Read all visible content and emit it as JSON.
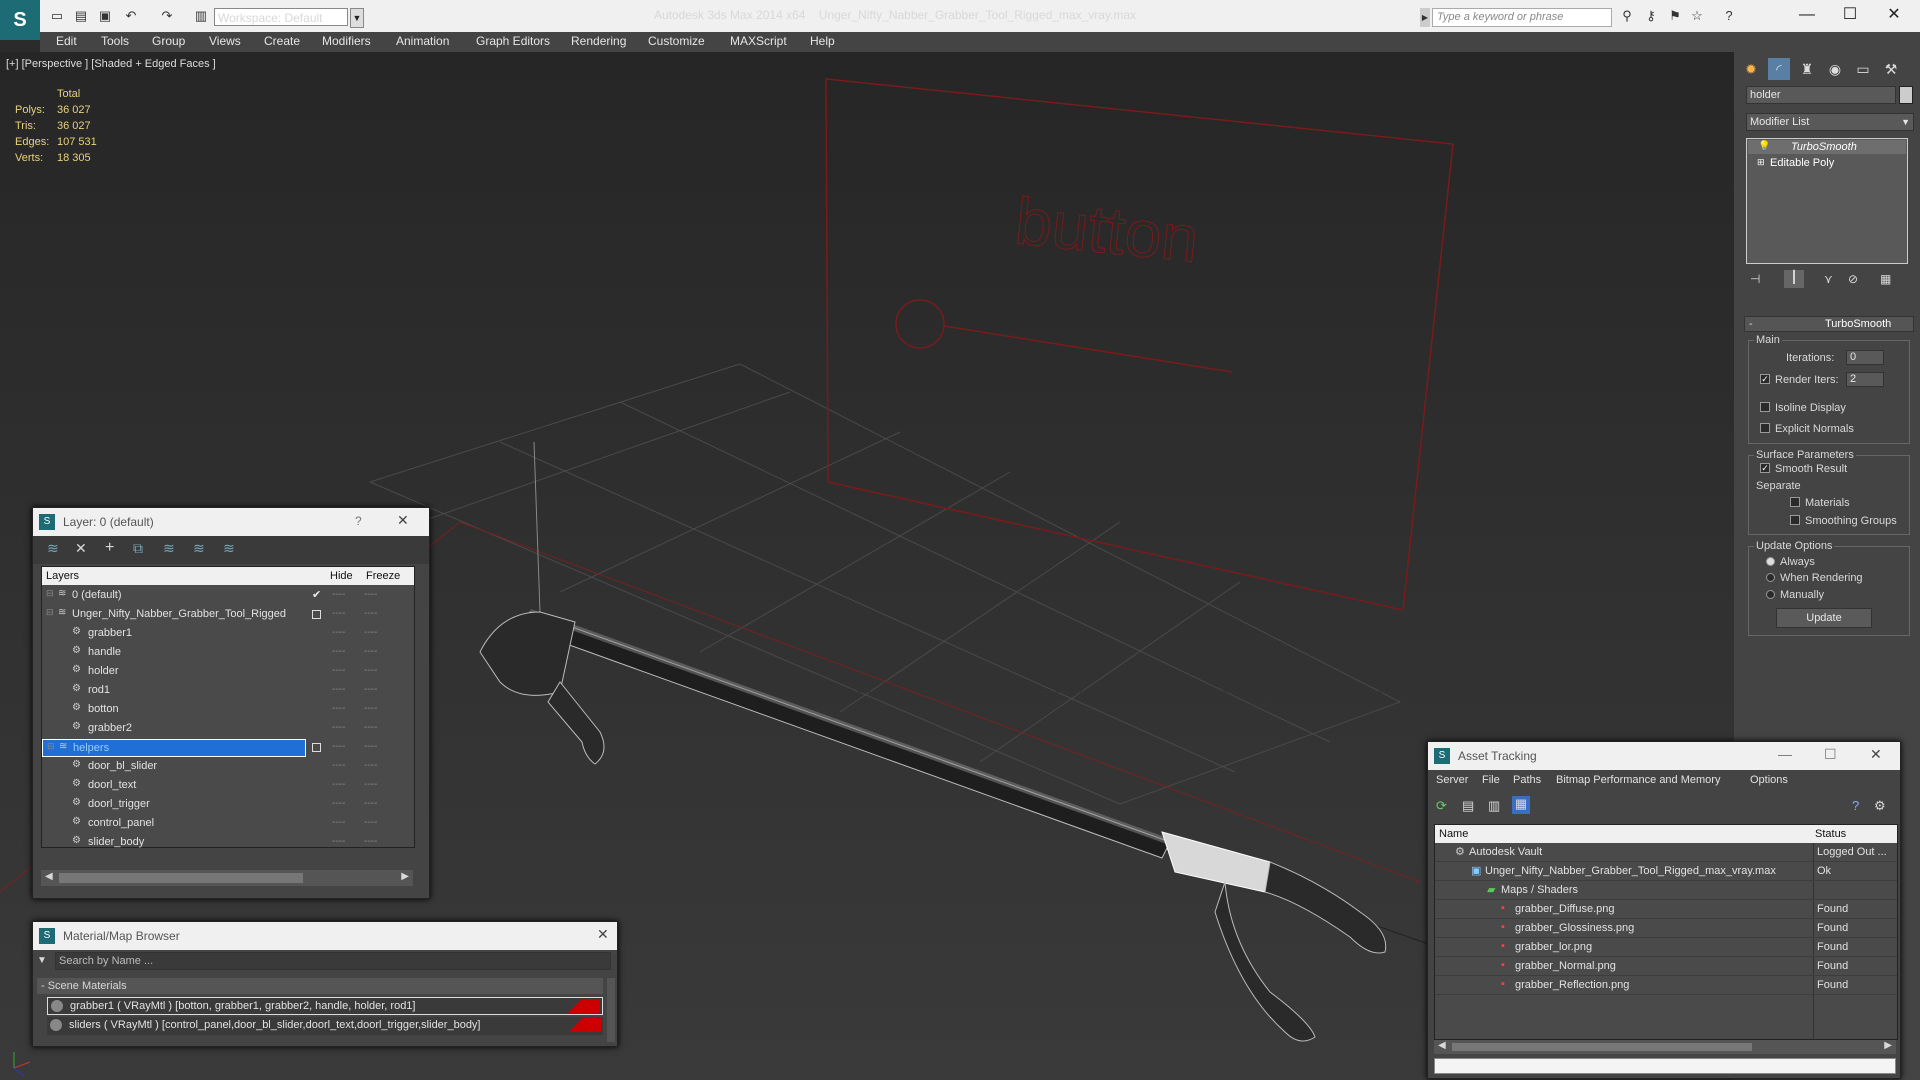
{
  "titlebar": {
    "app": "Autodesk 3ds Max  2014 x64",
    "file": "Unger_Nifty_Nabber_Grabber_Tool_Rigged_max_vray.max",
    "workspace": "Workspace: Default",
    "search_placeholder": "Type a keyword or phrase"
  },
  "menu": [
    "Edit",
    "Tools",
    "Group",
    "Views",
    "Create",
    "Modifiers",
    "Animation",
    "Graph Editors",
    "Rendering",
    "Customize",
    "MAXScript",
    "Help"
  ],
  "viewport": {
    "label": "[+] [Perspective ] [Shaded + Edged Faces ]",
    "stats_header": "Total",
    "stats": [
      {
        "k": "Polys:",
        "v": "36 027"
      },
      {
        "k": "Tris:",
        "v": "36 027"
      },
      {
        "k": "Edges:",
        "v": "107 531"
      },
      {
        "k": "Verts:",
        "v": "18 305"
      }
    ],
    "scene_text": "button"
  },
  "command_panel": {
    "object_name": "holder",
    "modifier_list": "Modifier List",
    "stack": [
      "TurboSmooth",
      "Editable Poly"
    ],
    "rollout": "TurboSmooth",
    "main": "Main",
    "iterations_label": "Iterations:",
    "iterations": "0",
    "render_iters_label": "Render Iters:",
    "render_iters": "2",
    "isoline": "Isoline Display",
    "explicit": "Explicit Normals",
    "surface": "Surface Parameters",
    "smooth_result": "Smooth Result",
    "separate": "Separate",
    "materials": "Materials",
    "smoothing_groups": "Smoothing Groups",
    "update_options": "Update Options",
    "always": "Always",
    "when_rendering": "When Rendering",
    "manually": "Manually",
    "update": "Update"
  },
  "layer_dialog": {
    "title": "Layer: 0 (default)",
    "help": "?",
    "col_layers": "Layers",
    "col_hide": "Hide",
    "col_freeze": "Freeze",
    "rows": [
      {
        "name": "0 (default)",
        "indent": 1
      },
      {
        "name": "Unger_Nifty_Nabber_Grabber_Tool_Rigged",
        "indent": 1
      },
      {
        "name": "grabber1",
        "indent": 2
      },
      {
        "name": "handle",
        "indent": 2
      },
      {
        "name": "holder",
        "indent": 2
      },
      {
        "name": "rod1",
        "indent": 2
      },
      {
        "name": "botton",
        "indent": 2
      },
      {
        "name": "grabber2",
        "indent": 2
      },
      {
        "name": "helpers",
        "indent": 1
      },
      {
        "name": "door_bl_slider",
        "indent": 2
      },
      {
        "name": "doorl_text",
        "indent": 2
      },
      {
        "name": "doorl_trigger",
        "indent": 2
      },
      {
        "name": "control_panel",
        "indent": 2
      },
      {
        "name": "slider_body",
        "indent": 2
      }
    ]
  },
  "material_browser": {
    "title": "Material/Map Browser",
    "search_placeholder": "Search by Name ...",
    "section": "- Scene Materials",
    "items": [
      "grabber1  ( VRayMtl )  [botton, grabber1, grabber2, handle, holder, rod1]",
      "sliders ( VRayMtl ) [control_panel,door_bl_slider,doorl_text,doorl_trigger,slider_body]"
    ]
  },
  "asset_tracking": {
    "title": "Asset Tracking",
    "menu": [
      "Server",
      "File",
      "Paths",
      "Bitmap Performance and Memory",
      "Options"
    ],
    "col_name": "Name",
    "col_status": "Status",
    "rows": [
      {
        "name": "Autodesk Vault",
        "status": "Logged Out ..."
      },
      {
        "name": "Unger_Nifty_Nabber_Grabber_Tool_Rigged_max_vray.max",
        "status": "Ok"
      },
      {
        "name": "Maps / Shaders",
        "status": ""
      },
      {
        "name": "grabber_Diffuse.png",
        "status": "Found"
      },
      {
        "name": "grabber_Glossiness.png",
        "status": "Found"
      },
      {
        "name": "grabber_lor.png",
        "status": "Found"
      },
      {
        "name": "grabber_Normal.png",
        "status": "Found"
      },
      {
        "name": "grabber_Reflection.png",
        "status": "Found"
      }
    ]
  }
}
